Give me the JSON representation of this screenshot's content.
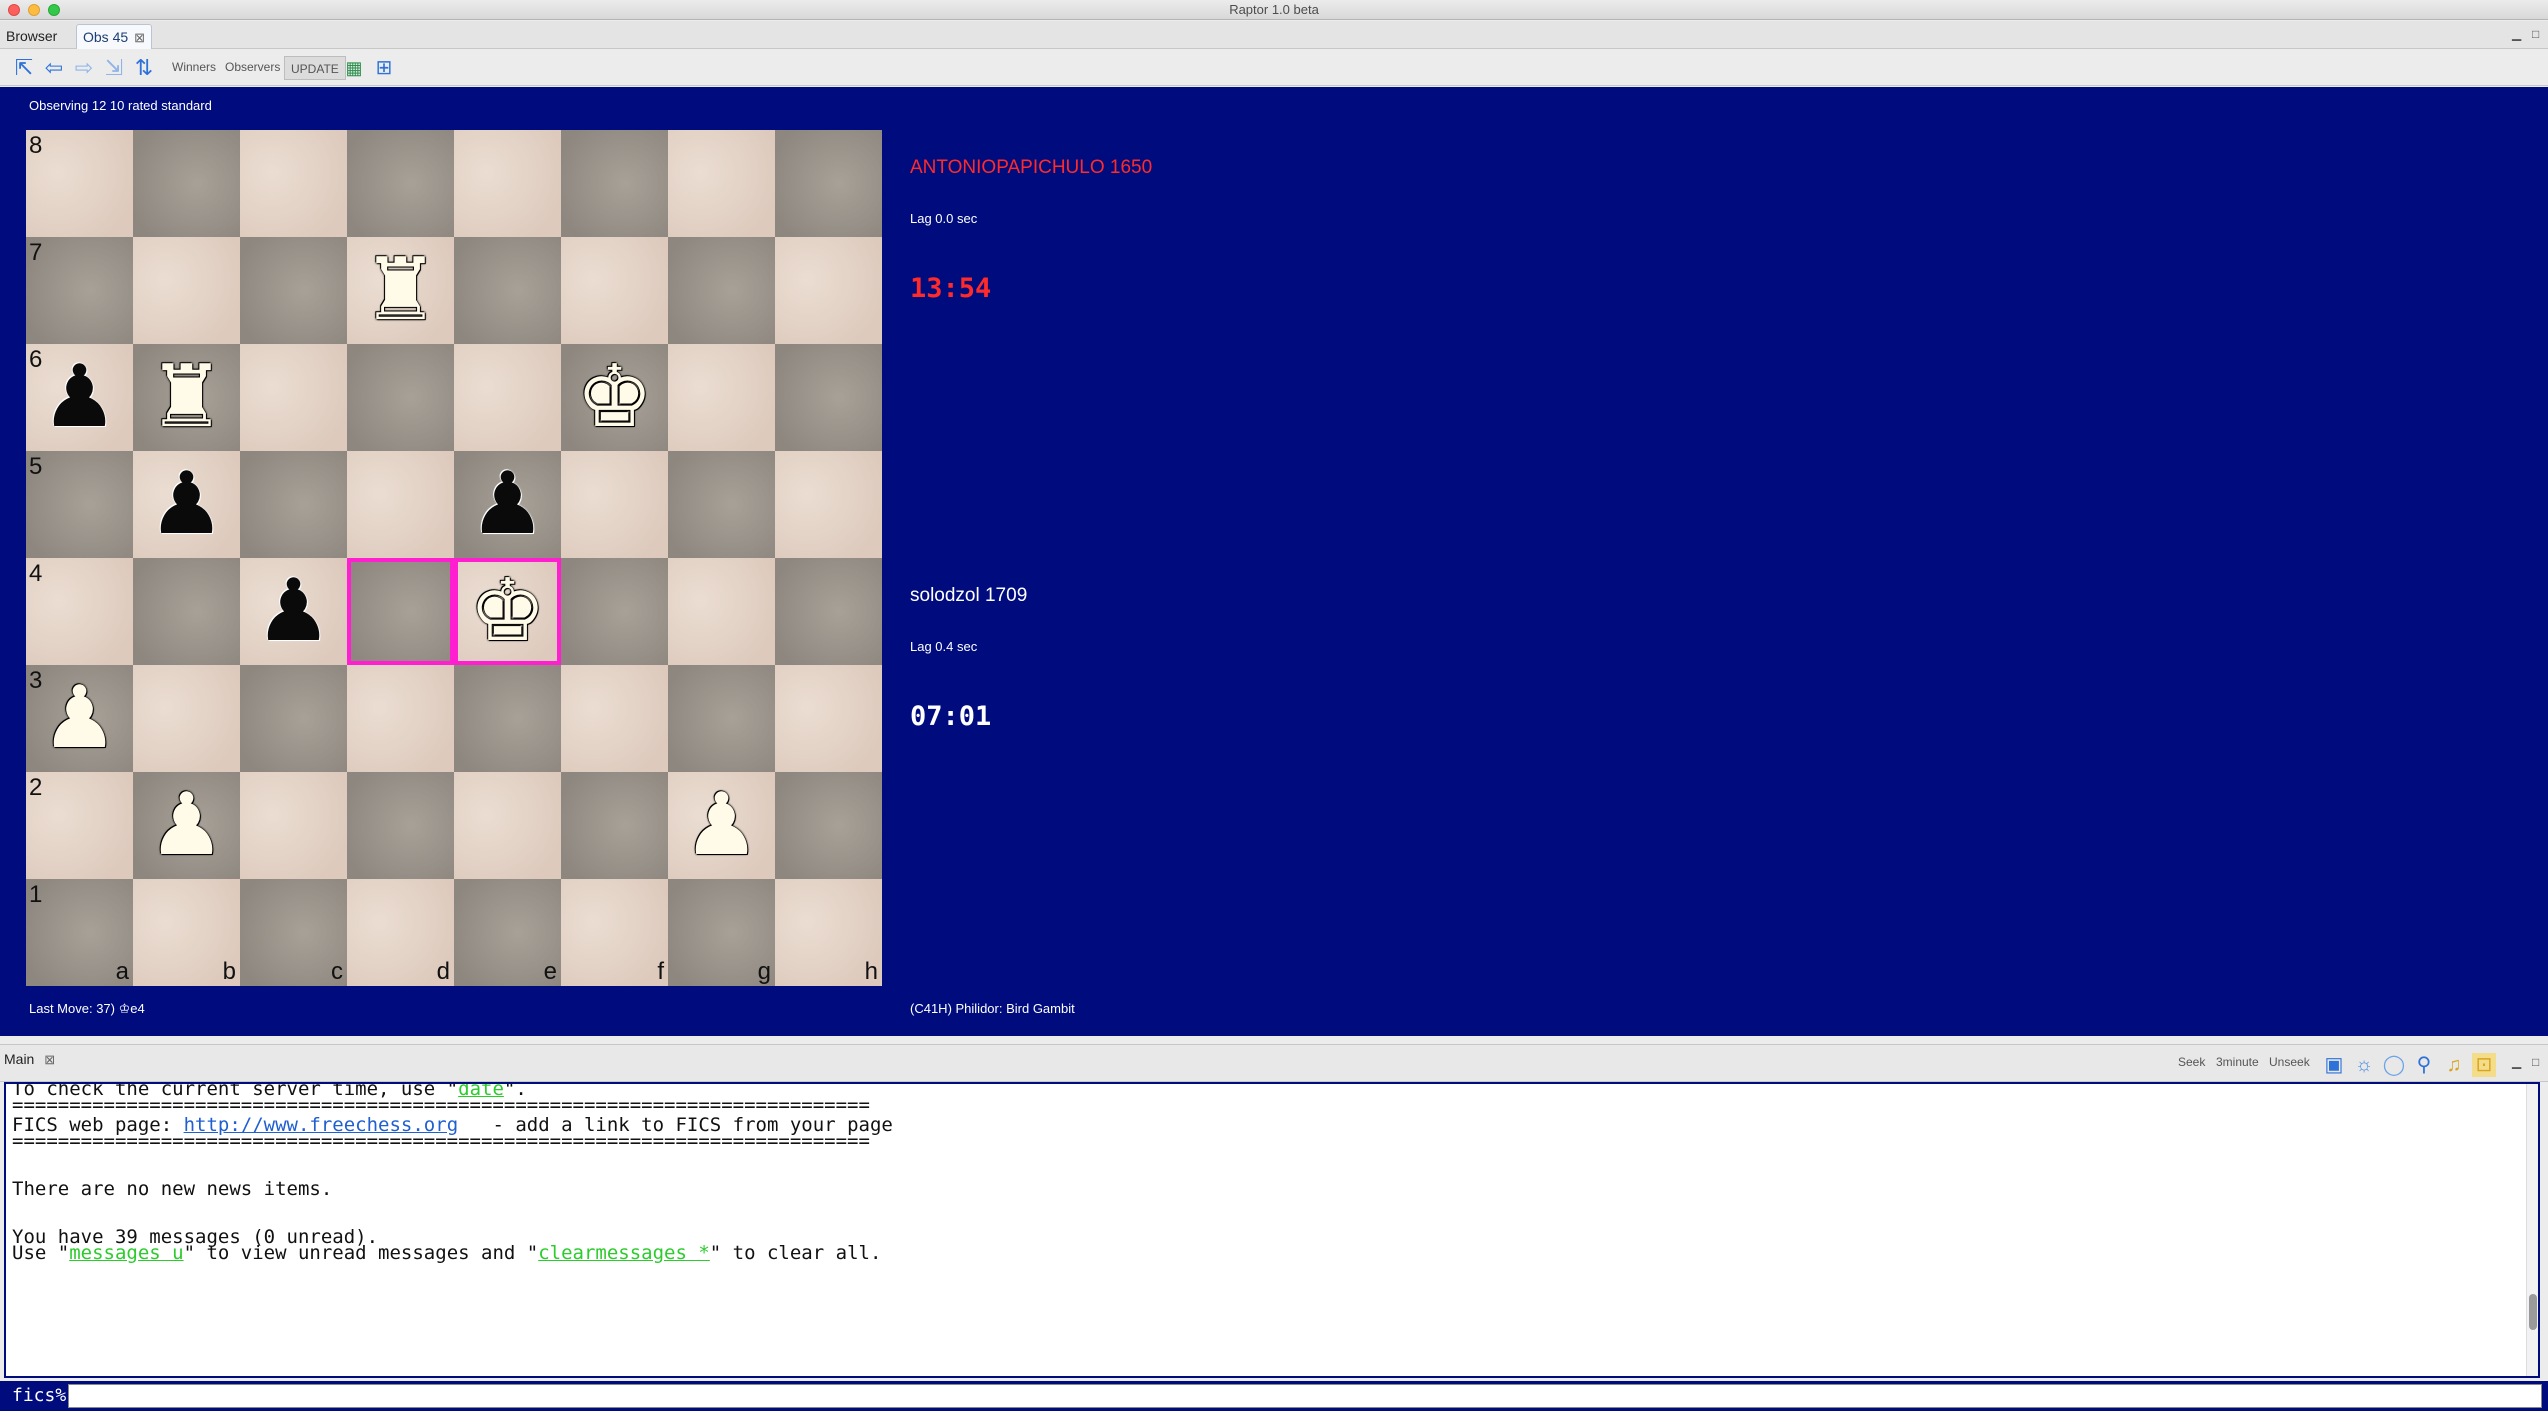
{
  "window": {
    "title": "Raptor 1.0 beta"
  },
  "top_tabs": [
    {
      "label": "Browser"
    },
    {
      "label": "Obs 45",
      "close": "⊠"
    }
  ],
  "toolbar": {
    "winners_label": "Winners",
    "observers_label": "Observers",
    "update_label": "UPDATE",
    "icons": [
      "first-move-icon",
      "back-icon",
      "forward-icon",
      "last-move-icon",
      "flip-board-icon",
      "calculator-icon",
      "grid-icon"
    ]
  },
  "game": {
    "status": "Observing 12 10 rated standard",
    "top_player": {
      "name": "ANTONIOPAPICHULO 1650",
      "lag": "Lag 0.0 sec",
      "clock": "13:54",
      "color": "#ff2a2a"
    },
    "bottom_player": {
      "name": "solodzol 1709",
      "lag": "Lag 0.4 sec",
      "clock": "07:01",
      "color": "#ffffff"
    },
    "last_move": "Last Move: 37) ♔e4",
    "opening": "(C41H) Philidor: Bird Gambit",
    "ranks": [
      "8",
      "7",
      "6",
      "5",
      "4",
      "3",
      "2",
      "1"
    ],
    "files": [
      "a",
      "b",
      "c",
      "d",
      "e",
      "f",
      "g",
      "h"
    ],
    "pieces": [
      {
        "square": "d7",
        "glyph": "♜",
        "color": "white",
        "name": "white-rook-d7"
      },
      {
        "square": "a6",
        "glyph": "♟",
        "color": "black",
        "name": "black-pawn-a6"
      },
      {
        "square": "b6",
        "glyph": "♜",
        "color": "white",
        "name": "white-rook-b6"
      },
      {
        "square": "f6",
        "glyph": "♚",
        "color": "white",
        "name": "white-king-f6"
      },
      {
        "square": "b5",
        "glyph": "♟",
        "color": "black",
        "name": "black-pawn-b5"
      },
      {
        "square": "e5",
        "glyph": "♟",
        "color": "black",
        "name": "black-pawn-e5"
      },
      {
        "square": "c4",
        "glyph": "♟",
        "color": "black",
        "name": "black-pawn-c4"
      },
      {
        "square": "e4",
        "glyph": "♚",
        "color": "white",
        "name": "white-king-e4"
      },
      {
        "square": "a3",
        "glyph": "♟",
        "color": "white",
        "name": "white-pawn-a3"
      },
      {
        "square": "b2",
        "glyph": "♟",
        "color": "white",
        "name": "white-pawn-b2"
      },
      {
        "square": "g2",
        "glyph": "♟",
        "color": "white",
        "name": "white-pawn-g2"
      }
    ],
    "highlighted_squares": [
      "d4",
      "e4"
    ]
  },
  "main_panel": {
    "tab_label": "Main",
    "tab_close": "⊠",
    "seek_label": "Seek",
    "threeminute_label": "3minute",
    "unseek_label": "Unseek",
    "lines": {
      "l1_pre": "To check the current server time, use \"",
      "l1_link": "date",
      "l1_post": "\".",
      "separator": "===========================================================================",
      "l3_pre": "FICS web page: ",
      "l3_link": "http://www.freechess.org",
      "l3_post": "   - add a link to FICS from your page",
      "l5": "There are no new news items.",
      "l7": "You have 39 messages (0 unread).",
      "l8_pre": "Use \"",
      "l8_link1": "messages u",
      "l8_mid": "\" to view unread messages and \"",
      "l8_link2": "clearmessages *",
      "l8_post": "\" to clear all."
    },
    "prompt": "fics%",
    "input_value": ""
  }
}
